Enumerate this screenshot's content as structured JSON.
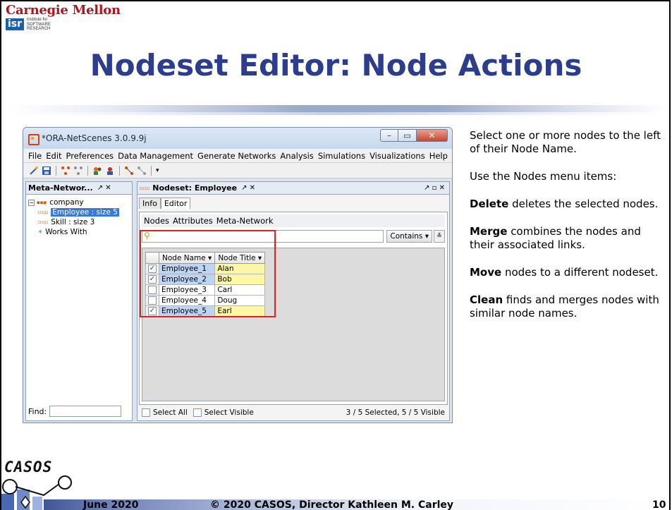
{
  "header": {
    "university": "Carnegie Mellon",
    "institute_abbrev": "isr",
    "institute_lines": [
      "institute for",
      "SOFTWARE",
      "RESEARCH"
    ]
  },
  "slide": {
    "title": "Nodeset Editor: Node Actions"
  },
  "app": {
    "window_title": "*ORA-NetScenes 3.0.9.9j",
    "menu": [
      "File",
      "Edit",
      "Preferences",
      "Data Management",
      "Generate Networks",
      "Analysis",
      "Simulations",
      "Visualizations",
      "Help"
    ],
    "left_pane": {
      "title": "Meta-Networ...",
      "controls": "↗ ✕",
      "tree": {
        "root": "company",
        "children": [
          {
            "label": "Employee : size 5",
            "selected": true
          },
          {
            "label": "Skill : size 3",
            "selected": false
          },
          {
            "label": "Works With",
            "selected": false
          }
        ]
      },
      "find_label": "Find:"
    },
    "right_pane": {
      "title": "Nodeset: Employee",
      "tabs": [
        "Info",
        "Editor"
      ],
      "editor_menu": [
        "Nodes",
        "Attributes",
        "Meta-Network"
      ],
      "contains_label": "Contains",
      "columns": [
        "Node Name",
        "Node Title"
      ],
      "rows": [
        {
          "checked": true,
          "name": "Employee_1",
          "title": "Alan"
        },
        {
          "checked": true,
          "name": "Employee_2",
          "title": "Bob"
        },
        {
          "checked": false,
          "name": "Employee_3",
          "title": "Carl"
        },
        {
          "checked": false,
          "name": "Employee_4",
          "title": "Doug"
        },
        {
          "checked": true,
          "name": "Employee_5",
          "title": "Earl"
        }
      ],
      "select_all_label": "Select All",
      "select_visible_label": "Select Visible",
      "status": "3 / 5 Selected, 5 / 5 Visible"
    }
  },
  "notes": [
    {
      "bold": "",
      "text": "Select one or more nodes to the left of their Node Name."
    },
    {
      "bold": "",
      "text": "Use the Nodes menu items:"
    },
    {
      "bold": "Delete",
      "text": " deletes the selected nodes."
    },
    {
      "bold": "Merge",
      "text": " combines the nodes and their associated links."
    },
    {
      "bold": "Move",
      "text": " nodes to a different nodeset."
    },
    {
      "bold": "Clean",
      "text": " finds and merges nodes with similar node names."
    }
  ],
  "footer": {
    "logo": "CASOS",
    "date": "June 2020",
    "copyright": "© 2020 CASOS, Director Kathleen M. Carley",
    "page": "10"
  }
}
